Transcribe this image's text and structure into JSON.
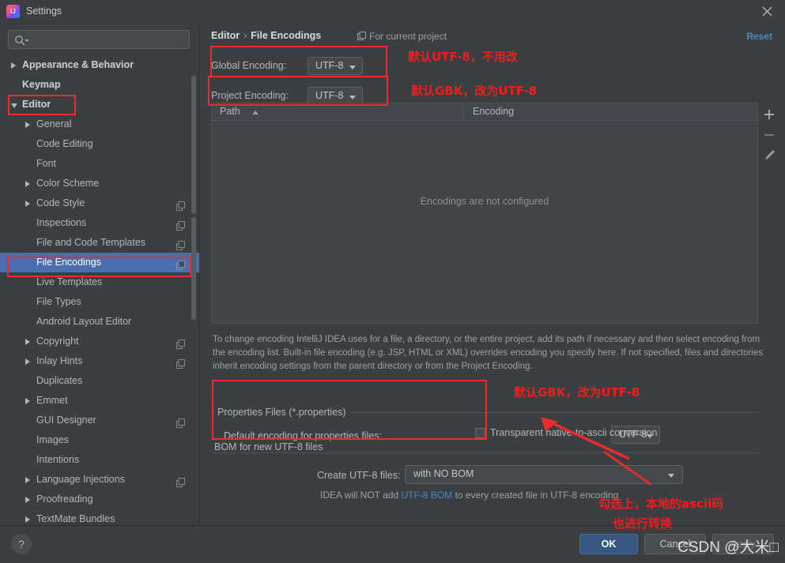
{
  "window": {
    "title": "Settings",
    "logo_icon": "intellij-idea-logo",
    "close_icon": "close-icon"
  },
  "search": {
    "icon": "search-icon",
    "value": "",
    "placeholder": ""
  },
  "sidebar": {
    "items": [
      {
        "label": "Appearance & Behavior",
        "arrow": "collapsed",
        "indent": 14,
        "bold": true,
        "badge": false,
        "selected": false
      },
      {
        "label": "Keymap",
        "arrow": "none",
        "indent": 28,
        "bold": true,
        "badge": false,
        "selected": false
      },
      {
        "label": "Editor",
        "arrow": "expanded",
        "indent": 14,
        "bold": true,
        "badge": false,
        "selected": false
      },
      {
        "label": "General",
        "arrow": "collapsed",
        "indent": 32,
        "bold": false,
        "badge": false,
        "selected": false
      },
      {
        "label": "Code Editing",
        "arrow": "none",
        "indent": 46,
        "bold": false,
        "badge": false,
        "selected": false
      },
      {
        "label": "Font",
        "arrow": "none",
        "indent": 46,
        "bold": false,
        "badge": false,
        "selected": false
      },
      {
        "label": "Color Scheme",
        "arrow": "collapsed",
        "indent": 32,
        "bold": false,
        "badge": false,
        "selected": false
      },
      {
        "label": "Code Style",
        "arrow": "collapsed",
        "indent": 32,
        "bold": false,
        "badge": true,
        "selected": false
      },
      {
        "label": "Inspections",
        "arrow": "none",
        "indent": 46,
        "bold": false,
        "badge": true,
        "selected": false
      },
      {
        "label": "File and Code Templates",
        "arrow": "none",
        "indent": 46,
        "bold": false,
        "badge": true,
        "selected": false
      },
      {
        "label": "File Encodings",
        "arrow": "none",
        "indent": 46,
        "bold": false,
        "badge": true,
        "selected": true
      },
      {
        "label": "Live Templates",
        "arrow": "none",
        "indent": 46,
        "bold": false,
        "badge": false,
        "selected": false
      },
      {
        "label": "File Types",
        "arrow": "none",
        "indent": 46,
        "bold": false,
        "badge": false,
        "selected": false
      },
      {
        "label": "Android Layout Editor",
        "arrow": "none",
        "indent": 46,
        "bold": false,
        "badge": false,
        "selected": false
      },
      {
        "label": "Copyright",
        "arrow": "collapsed",
        "indent": 32,
        "bold": false,
        "badge": true,
        "selected": false
      },
      {
        "label": "Inlay Hints",
        "arrow": "collapsed",
        "indent": 32,
        "bold": false,
        "badge": true,
        "selected": false
      },
      {
        "label": "Duplicates",
        "arrow": "none",
        "indent": 46,
        "bold": false,
        "badge": false,
        "selected": false
      },
      {
        "label": "Emmet",
        "arrow": "collapsed",
        "indent": 32,
        "bold": false,
        "badge": false,
        "selected": false
      },
      {
        "label": "GUI Designer",
        "arrow": "none",
        "indent": 46,
        "bold": false,
        "badge": true,
        "selected": false
      },
      {
        "label": "Images",
        "arrow": "none",
        "indent": 46,
        "bold": false,
        "badge": false,
        "selected": false
      },
      {
        "label": "Intentions",
        "arrow": "none",
        "indent": 46,
        "bold": false,
        "badge": false,
        "selected": false
      },
      {
        "label": "Language Injections",
        "arrow": "collapsed",
        "indent": 32,
        "bold": false,
        "badge": true,
        "selected": false
      },
      {
        "label": "Proofreading",
        "arrow": "collapsed",
        "indent": 32,
        "bold": false,
        "badge": false,
        "selected": false
      },
      {
        "label": "TextMate Bundles",
        "arrow": "collapsed",
        "indent": 32,
        "bold": false,
        "badge": false,
        "selected": false
      }
    ]
  },
  "content": {
    "breadcrumb_parent": "Editor",
    "breadcrumb_sep": "›",
    "breadcrumb_current": "File Encodings",
    "for_current_project": "For current project",
    "for_current_project_icon": "project-scope-icon",
    "reset_label": "Reset",
    "global_encoding": {
      "label": "Global Encoding:",
      "value": "UTF-8"
    },
    "project_encoding": {
      "label": "Project Encoding:",
      "value": "UTF-8"
    },
    "table": {
      "columns": [
        "Path",
        "Encoding"
      ],
      "sort_column": "Path",
      "sort_direction": "ascending",
      "rows": [],
      "empty_message": "Encodings are not configured",
      "tools": [
        {
          "name": "add-button",
          "glyph": "+"
        },
        {
          "name": "remove-button",
          "glyph": "−"
        },
        {
          "name": "edit-button",
          "glyph": "pencil"
        }
      ]
    },
    "description": "To change encoding IntelliJ IDEA uses for a file, a directory, or the entire project, add its path if necessary and then select encoding from the encoding list. Built-in file encoding (e.g. JSP, HTML or XML) overrides encoding you specify here. If not specified, files and directories inherit encoding settings from the parent directory or from the Project Encoding.",
    "properties_group": {
      "title": "Properties Files (*.properties)",
      "default_encoding_label": "Default encoding for properties files:",
      "default_encoding_value": "UTF-8",
      "transparent_label": "Transparent native-to-ascii conversion",
      "transparent_checked": false
    },
    "bom_group": {
      "title": "BOM for new UTF-8 files",
      "create_label": "Create UTF-8 files:",
      "create_value": "with NO BOM",
      "hint_prefix": "IDEA will NOT add ",
      "hint_link": "UTF-8 BOM",
      "hint_suffix": " to every created file in UTF-8 encoding"
    }
  },
  "footer": {
    "help_label": "?",
    "ok_label": "OK",
    "cancel_label": "Cancel",
    "apply_label": "Apply"
  },
  "annotations": {
    "accent_color": "#ec2b2b",
    "note_global": "默认UTF-8，不用改",
    "note_project": "默认GBK，改为UTF-8",
    "note_properties": "默认GBK，改为UTF-8",
    "note_ascii_line1": "勾选上，本地的ascii码",
    "note_ascii_line2": "也进行转换"
  },
  "watermark": "CSDN @大米□"
}
